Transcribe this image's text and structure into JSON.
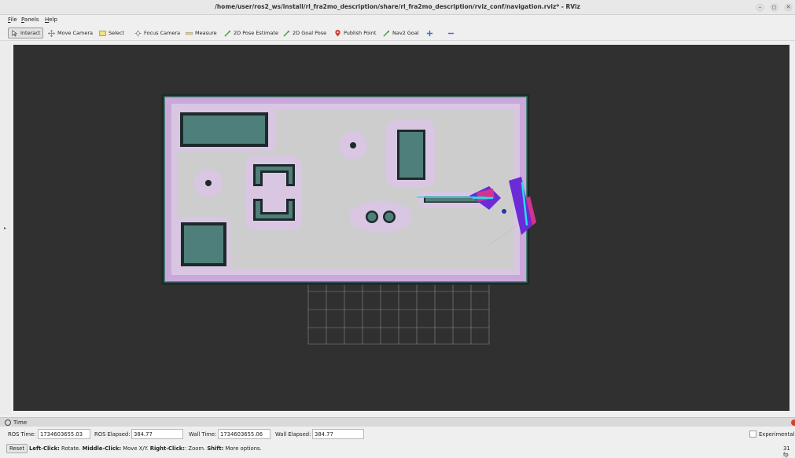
{
  "window": {
    "title": "/home/user/ros2_ws/install/rl_fra2mo_description/share/rl_fra2mo_description/rviz_conf/navigation.rviz* - RViz",
    "minimize_glyph": "–",
    "maximize_glyph": "◻",
    "close_glyph": "✕"
  },
  "menu": {
    "items": [
      {
        "underline": "F",
        "rest": "ile"
      },
      {
        "underline": "P",
        "rest": "anels"
      },
      {
        "underline": "H",
        "rest": "elp"
      }
    ]
  },
  "toolbar": {
    "tools": [
      {
        "label": "Interact",
        "icon": "cursor-icon",
        "active": true
      },
      {
        "label": "Move Camera",
        "icon": "move-camera-icon"
      },
      {
        "label": "Select",
        "icon": "select-icon"
      },
      {
        "label": "Focus Camera",
        "icon": "focus-camera-icon"
      },
      {
        "label": "Measure",
        "icon": "measure-icon"
      },
      {
        "label": "2D Pose Estimate",
        "icon": "pose-estimate-icon"
      },
      {
        "label": "2D Goal Pose",
        "icon": "goal-pose-icon"
      },
      {
        "label": "Publish Point",
        "icon": "publish-point-icon"
      },
      {
        "label": "Nav2 Goal",
        "icon": "nav2-goal-icon"
      }
    ],
    "add_icon": "plus-icon",
    "remove_icon": "minus-icon"
  },
  "time_panel": {
    "title": "Time",
    "ros_time_label": "ROS Time:",
    "ros_time": "1734603655.03",
    "ros_elapsed_label": "ROS Elapsed:",
    "ros_elapsed": "384.77",
    "wall_time_label": "Wall Time:",
    "wall_time": "1734603655.06",
    "wall_elapsed_label": "Wall Elapsed:",
    "wall_elapsed": "384.77",
    "experimental_label": "Experimental"
  },
  "status": {
    "reset_label": "Reset",
    "hint_left_bold": "Left-Click:",
    "hint_left": " Rotate. ",
    "hint_middle_bold": "Middle-Click:",
    "hint_middle": " Move X/Y. ",
    "hint_right_bold": "Right-Click:",
    "hint_right": ": Zoom. ",
    "hint_shift_bold": "Shift:",
    "hint_shift": " More options.",
    "fps": "31 fp"
  },
  "colors": {
    "viewport_bg": "#303030",
    "map_free": "#cdcdcd",
    "costmap_inflation": "#c9a9d9",
    "obstacle": "#4f7f7a",
    "laser": "#22e0e8",
    "robot_footprint": "#6b2bd6"
  }
}
